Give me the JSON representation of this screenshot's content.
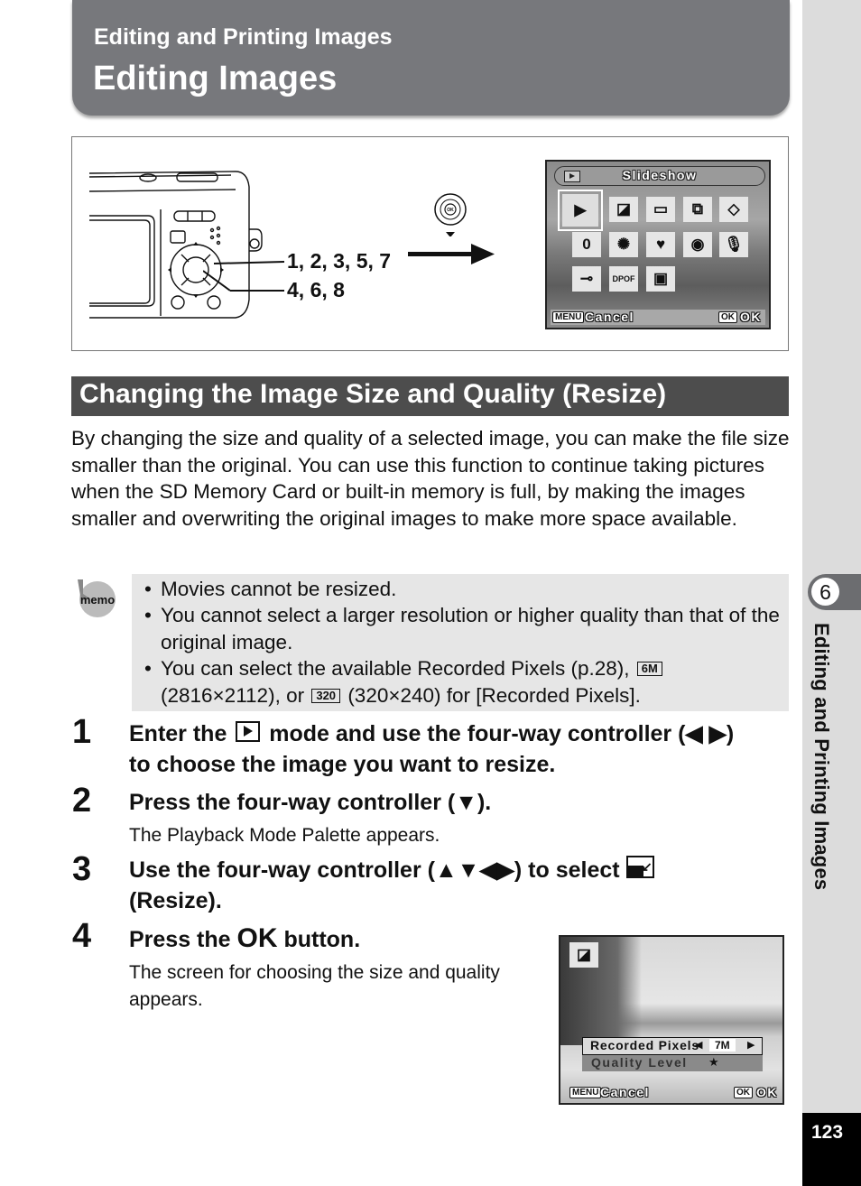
{
  "header": {
    "section": "Editing and Printing Images",
    "title": "Editing Images"
  },
  "sidebar": {
    "chapter_number": "6",
    "chapter_label": "Editing and Printing Images",
    "page_number": "123"
  },
  "illustration": {
    "callouts": [
      "1, 2, 3, 5, 7",
      "4, 6, 8"
    ],
    "controller_icon": "four-way-controller-down-icon",
    "palette_screen": {
      "title": "Slideshow",
      "mode_icon": "playback-icon",
      "icons": [
        "slideshow-icon",
        "resize-icon",
        "cropping-icon",
        "image-copy-icon",
        "rotate-icon",
        "color-filter-icon",
        "brightness-filter-icon",
        "frame-composite-icon",
        "red-eye-edit-icon",
        "voice-memo-icon",
        "protect-icon",
        "dpof-icon",
        "start-up-screen-icon"
      ],
      "footer_left_key": "MENU",
      "footer_left_label": "Cancel",
      "footer_right_key": "OK",
      "footer_right_label": "OK"
    }
  },
  "section": {
    "heading": "Changing the Image Size and Quality (Resize)",
    "intro": "By changing the size and quality of a selected image, you can make the file size smaller than the original. You can use this function to continue taking pictures when the SD Memory Card or built-in memory is full, by making the images smaller and overwriting the original images to make more space available."
  },
  "memo": {
    "icon": "memo-icon",
    "items": [
      {
        "text": "Movies cannot be resized."
      },
      {
        "text": "You cannot select a larger resolution or higher quality than that of the original image."
      },
      {
        "pre": "You can select the available Recorded Pixels (p.28),",
        "badge1": "6M",
        "mid": "(2816×2112), or",
        "badge2": "320",
        "post": "(320×240) for [Recorded Pixels]."
      }
    ]
  },
  "steps": [
    {
      "num": "1",
      "pre": "Enter the",
      "post": "mode and use the four-way controller (◀ ▶) to choose the image you want to resize."
    },
    {
      "num": "2",
      "text": "Press the four-way controller (▼).",
      "sub": "The Playback Mode Palette appears."
    },
    {
      "num": "3",
      "pre": "Use the four-way controller (▲▼◀▶) to select",
      "post": "(Resize)."
    },
    {
      "num": "4",
      "pre": "Press the",
      "ok": "OK",
      "post": "button.",
      "sub": "The screen for choosing the size and quality appears."
    }
  ],
  "resize_screen": {
    "mode_icon": "resize-icon",
    "rows": [
      {
        "label": "Recorded Pixels",
        "value": "7M"
      },
      {
        "label": "Quality Level",
        "value": "★"
      }
    ],
    "footer_left_key": "MENU",
    "footer_left_label": "Cancel",
    "footer_right_key": "OK",
    "footer_right_label": "OK"
  }
}
